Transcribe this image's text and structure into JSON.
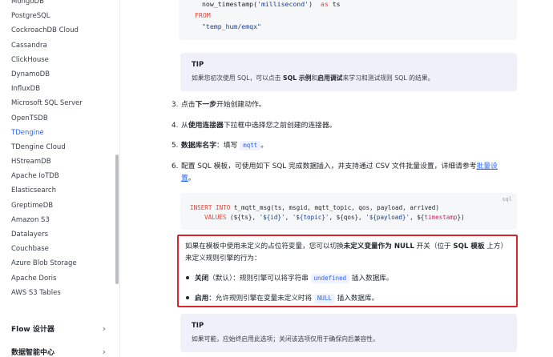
{
  "sidebar": {
    "items": [
      {
        "label": "MongoDB",
        "active": false
      },
      {
        "label": "PostgreSQL",
        "active": false
      },
      {
        "label": "CockroachDB Cloud",
        "active": false
      },
      {
        "label": "Cassandra",
        "active": false
      },
      {
        "label": "ClickHouse",
        "active": false
      },
      {
        "label": "DynamoDB",
        "active": false
      },
      {
        "label": "InfluxDB",
        "active": false
      },
      {
        "label": "Microsoft SQL Server",
        "active": false
      },
      {
        "label": "OpenTSDB",
        "active": false
      },
      {
        "label": "TDengine",
        "active": true
      },
      {
        "label": "TDengine Cloud",
        "active": false
      },
      {
        "label": "HStreamDB",
        "active": false
      },
      {
        "label": "Apache IoTDB",
        "active": false
      },
      {
        "label": "Elasticsearch",
        "active": false
      },
      {
        "label": "GreptimeDB",
        "active": false
      },
      {
        "label": "Amazon S3",
        "active": false
      },
      {
        "label": "Datalayers",
        "active": false
      },
      {
        "label": "Couchbase",
        "active": false
      },
      {
        "label": "Azure Blob Storage",
        "active": false
      },
      {
        "label": "Apache Doris",
        "active": false
      },
      {
        "label": "AWS S3 Tables",
        "active": false
      }
    ],
    "groups": [
      {
        "label": "Flow 设计器"
      },
      {
        "label": "数据智能中心"
      }
    ]
  },
  "code_top": {
    "line1_fn": "now_timestamp(",
    "line1_str": "'millisecond'",
    "line1_close": ")",
    "line1_as": "as",
    "line1_alias": "ts",
    "line2_kw": "FROM",
    "line3_str": "\"temp_hum/emqx\""
  },
  "tip1": {
    "title": "TIP",
    "body_pre": "如果您初次使用 SQL，可以点击 ",
    "body_b1": "SQL 示例",
    "body_mid": "和",
    "body_b2": "启用调试",
    "body_post": "来学习和测试规则 SQL 的结果。"
  },
  "steps": {
    "s3": {
      "num": "3.",
      "pre": "点击",
      "bold": "下一步",
      "post": "开始创建动作。"
    },
    "s4": {
      "num": "4.",
      "pre": "从",
      "bold": "使用连接器",
      "post": "下拉框中选择您之前创建的连接器。"
    },
    "s5": {
      "num": "5.",
      "bold": "数据库名字",
      "pre": "：填写 ",
      "tag": "mqtt",
      "post": "。"
    },
    "s6": {
      "num": "6.",
      "line1": "配置 SQL 模板，可使用如下 SQL 完成数据插入，并支持通过 CSV 文件批量设置，详细请参考",
      "link_a": "批量设",
      "link_b": "置",
      "end": "。"
    }
  },
  "code_sql": {
    "lang": "sql",
    "l1_kw": "INSERT INTO",
    "l1_rest": " t_mqtt_msg(ts, msgid, mqtt_topic, qos, payload, arrived)",
    "l2_kw": "VALUES",
    "l2_p1": " (${ts}, ",
    "l2_s1": "'${id}'",
    "l2_p2": ", ",
    "l2_s2": "'${topic}'",
    "l2_p3": ", ${qos}, ",
    "l2_s3": "'${payload}'",
    "l2_p4": ", ${",
    "l2_v": "timestamp",
    "l2_p5": "})"
  },
  "callout": {
    "p_pre": "如果在模板中使用未定义的占位符变量，您可以切换",
    "p_b1": "未定义变量作为 NULL",
    "p_mid": " 开关（位于 ",
    "p_b2": "SQL 模板",
    "p_post": " 上方）",
    "p_line2": "来定义规则引擎的行为：",
    "b1_bold": "关闭",
    "b1_pre": "（默认）：规则引擎可以将字符串 ",
    "b1_tag": "undefined",
    "b1_post": " 插入数据库。",
    "b2_bold": "启用",
    "b2_pre": "：允许规则引擎在变量未定义时将 ",
    "b2_tag": "NULL",
    "b2_post": " 插入数据库。"
  },
  "tip2": {
    "title": "TIP",
    "body": "如果可能，应始终启用此选项；关闭该选项仅用于确保向后兼容性。"
  },
  "colors": {
    "accent": "#2b67f6",
    "callout_border": "#d9262c",
    "tip_bg": "#f0f0fb",
    "code_bg": "#f6f7f9"
  }
}
